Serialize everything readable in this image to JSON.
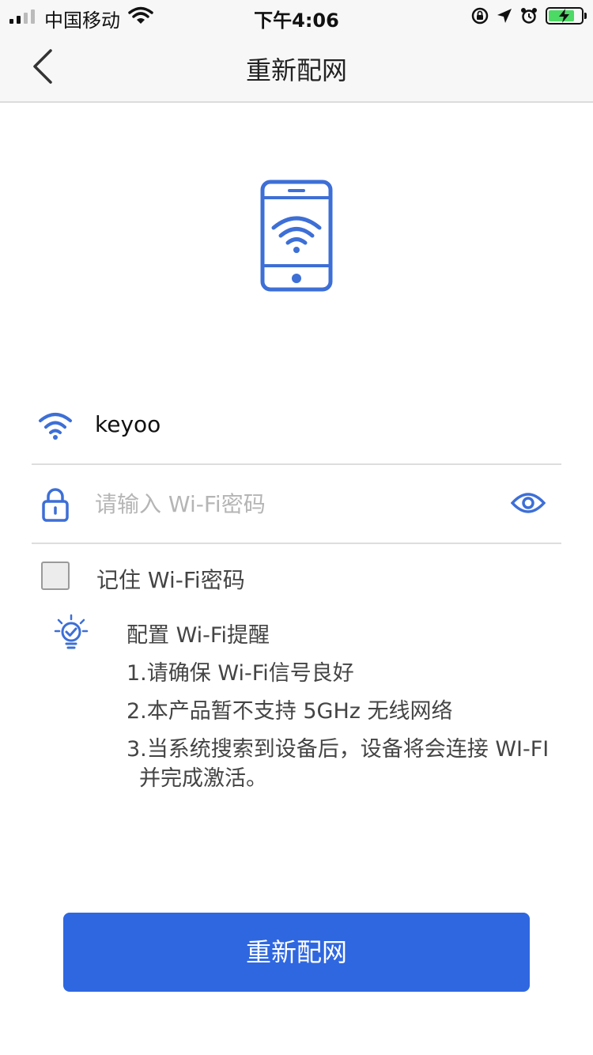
{
  "status_bar": {
    "carrier": "中国移动",
    "time": "下午4:06",
    "battery_level": 0.8,
    "battery_color": "#4cd964"
  },
  "nav": {
    "title": "重新配网",
    "back_icon": "chevron-left-icon"
  },
  "hero": {
    "icon": "phone-wifi-icon",
    "color": "#3d6fd6"
  },
  "network": {
    "ssid": "keyoo",
    "ssid_icon": "wifi-icon",
    "password_value": "",
    "password_placeholder": "请输入 Wi-Fi密码",
    "lock_icon": "lock-icon",
    "visibility_icon": "eye-icon"
  },
  "remember": {
    "checked": false,
    "label": "记住 Wi-Fi密码"
  },
  "tips": {
    "icon": "lightbulb-check-icon",
    "title": "配置 Wi-Fi提醒",
    "items": [
      "1.请确保 Wi-Fi信号良好",
      "2.本产品暂不支持 5GHz 无线网络",
      "3.当系统搜索到设备后，设备将会连接 WI-FI",
      "并完成激活。"
    ]
  },
  "submit_button": {
    "label": "重新配网",
    "color": "#2f67e0"
  }
}
